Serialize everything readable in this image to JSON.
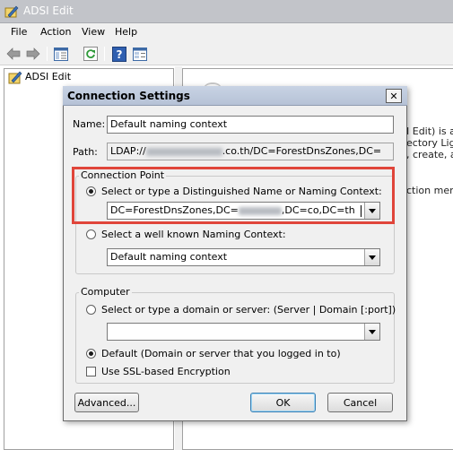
{
  "window": {
    "title": "ADSI Edit",
    "menu": [
      "File",
      "Action",
      "View",
      "Help"
    ],
    "toolbar_icons": [
      "back-arrow-icon",
      "forward-arrow-icon",
      "show-hide-tree-icon",
      "refresh-icon",
      "help-icon",
      "properties-icon"
    ]
  },
  "tree": {
    "root_label": "ADSI Edit"
  },
  "background_text": {
    "line1": "I Edit) is a l",
    "line2": "ectory Ligh",
    "line3": ", create, a",
    "line4": "ction menu,"
  },
  "dialog": {
    "title": "Connection Settings",
    "close_label": "✕",
    "name_label": "Name:",
    "name_value": "Default naming context",
    "path_label": "Path:",
    "path_prefix": "LDAP://",
    "path_mid": ".co.th/DC=ForestDnsZones,DC=",
    "connection_point": {
      "title": "Connection Point",
      "option_dn_label": "Select or type a Distinguished Name or Naming Context:",
      "dn_prefix": "DC=ForestDnsZones,DC=",
      "dn_suffix": ",DC=co,DC=th",
      "option_wellknown_label": "Select a well known Naming Context:",
      "wellknown_value": "Default naming context"
    },
    "computer": {
      "title": "Computer",
      "option_server_label": "Select or type a domain or server: (Server | Domain [:port])",
      "server_value": "",
      "option_default_label": "Default (Domain or server that you logged in to)",
      "ssl_label": "Use SSL-based Encryption"
    },
    "buttons": {
      "advanced": "Advanced...",
      "ok": "OK",
      "cancel": "Cancel"
    }
  },
  "colors": {
    "highlight": "#e0453a",
    "title_bar": "#c2c4c9"
  }
}
